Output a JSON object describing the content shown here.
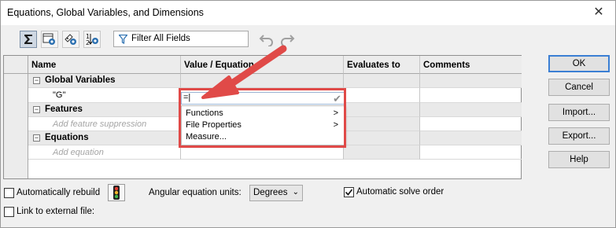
{
  "window": {
    "title": "Equations, Global Variables, and Dimensions",
    "close_glyph": "✕"
  },
  "toolbar": {
    "buttons": [
      {
        "icon": "sigma-icon",
        "active": true
      },
      {
        "icon": "view-icon",
        "active": false
      },
      {
        "icon": "dimension-view-icon",
        "active": false
      },
      {
        "icon": "order-view-icon",
        "active": false
      }
    ],
    "filter_placeholder": "Filter All Fields",
    "undo_icon": "undo-icon",
    "redo_icon": "redo-icon"
  },
  "table": {
    "headers": {
      "name": "Name",
      "value": "Value / Equation",
      "evaluates": "Evaluates to",
      "comments": "Comments"
    },
    "groups": {
      "global_variables": "Global Variables",
      "features": "Features",
      "equations": "Equations"
    },
    "rows": {
      "g_name": "\"G\"",
      "g_value": "=|",
      "features_placeholder": "Add feature suppression",
      "equations_placeholder": "Add equation"
    },
    "dropdown": [
      {
        "label": "Functions",
        "arrow": ">"
      },
      {
        "label": "File Properties",
        "arrow": ">"
      },
      {
        "label": "Measure...",
        "arrow": ""
      }
    ]
  },
  "buttons": {
    "ok": "OK",
    "cancel": "Cancel",
    "import": "Import...",
    "export": "Export...",
    "help": "Help"
  },
  "options": {
    "auto_rebuild": {
      "label": "Automatically rebuild",
      "checked": false
    },
    "link_external": {
      "label": "Link to external file:",
      "checked": false
    },
    "angular_units_label": "Angular equation units:",
    "angular_units_value": "Degrees",
    "auto_solve": {
      "label": "Automatic solve order",
      "checked": true
    }
  },
  "colors": {
    "annotation_red": "#e04a48",
    "default_button_border": "#3b7fd4"
  }
}
